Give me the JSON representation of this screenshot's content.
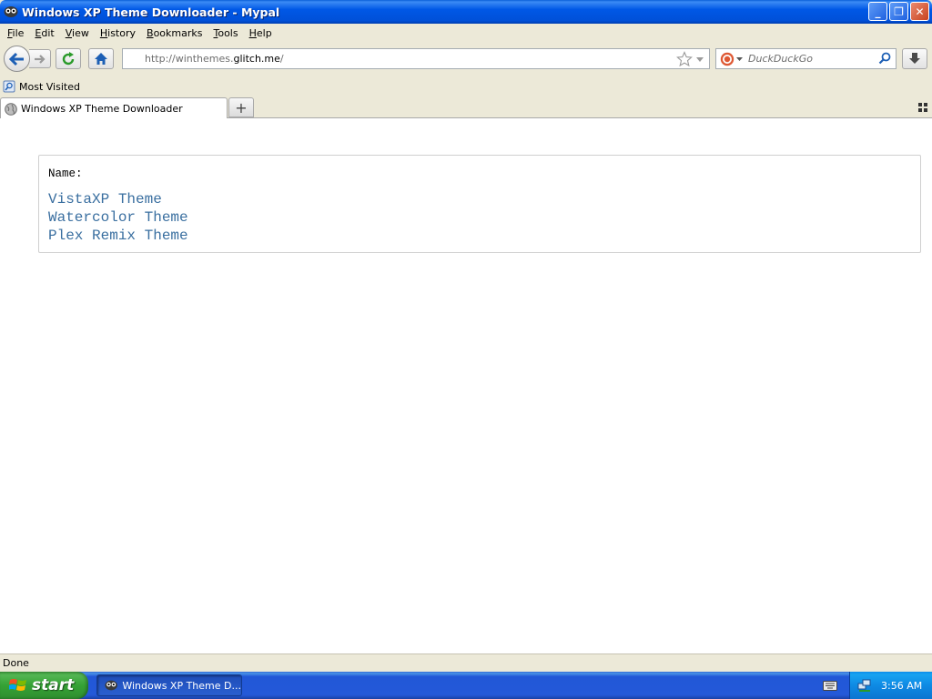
{
  "window": {
    "title": "Windows XP Theme Downloader - Mypal",
    "buttons": {
      "minimize": "_",
      "maximize": "❐",
      "close": "✕"
    }
  },
  "menubar": {
    "items": [
      "File",
      "Edit",
      "View",
      "History",
      "Bookmarks",
      "Tools",
      "Help"
    ]
  },
  "navbar": {
    "url_prefix": "http://winthemes.",
    "url_host": "glitch.me",
    "url_suffix": "/",
    "search_placeholder": "DuckDuckGo",
    "icons": [
      "back-icon",
      "forward-icon",
      "reload-icon",
      "home-icon",
      "bookmark-star-icon",
      "dropmarker-icon",
      "search-engine-icon",
      "search-icon",
      "download-icon"
    ]
  },
  "bookmarks": {
    "items": [
      {
        "label": "Most Visited",
        "icon": "folder-icon"
      }
    ]
  },
  "tabs": {
    "items": [
      {
        "label": "Windows XP Theme Downloader",
        "icon": "globe-icon"
      }
    ],
    "new_tab_label": "+"
  },
  "page": {
    "name_label": "Name:",
    "themes": [
      "VistaXP Theme",
      "Watercolor Theme",
      "Plex Remix Theme"
    ],
    "link_color": "#3a6fa0"
  },
  "statusbar": {
    "text": "Done"
  },
  "taskbar": {
    "start_label": "start",
    "task_label": "Windows XP Theme D...",
    "clock": "3:56 AM"
  }
}
